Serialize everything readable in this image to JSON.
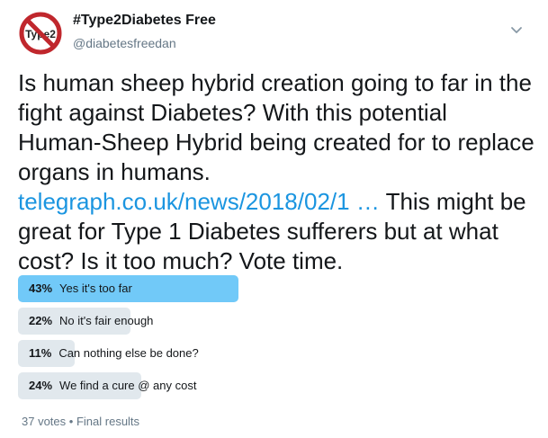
{
  "account": {
    "display_name": "#Type2Diabetes Free",
    "handle": "@diabetesfreedan",
    "avatar_text": "Type2"
  },
  "tweet": {
    "text_part1": "Is human sheep hybrid creation going to far in the fight against Diabetes? With this potential Human-Sheep Hybrid being created for to replace organs in humans. ",
    "link_text": "telegraph.co.uk/news/2018/02/1 …",
    "text_part2": " This might be great for Type 1 Diabetes sufferers but at what cost? Is it too much? Vote time."
  },
  "poll": {
    "options": [
      {
        "percent": "43%",
        "label": "Yes it's too far",
        "value": 43,
        "winner": true
      },
      {
        "percent": "22%",
        "label": "No it's fair enough",
        "value": 22,
        "winner": false
      },
      {
        "percent": "11%",
        "label": "Can nothing else be done?",
        "value": 11,
        "winner": false
      },
      {
        "percent": "24%",
        "label": "We find a cure @ any cost",
        "value": 24,
        "winner": false
      }
    ],
    "votes": "37 votes",
    "separator": "•",
    "status": "Final results"
  },
  "colors": {
    "winner_bar": "#71c9f8",
    "other_bar": "#e1e8ed",
    "link": "#1b95e0",
    "avatar_ring": "#c0272d"
  },
  "icons": {
    "menu": "chevron-down-icon"
  }
}
